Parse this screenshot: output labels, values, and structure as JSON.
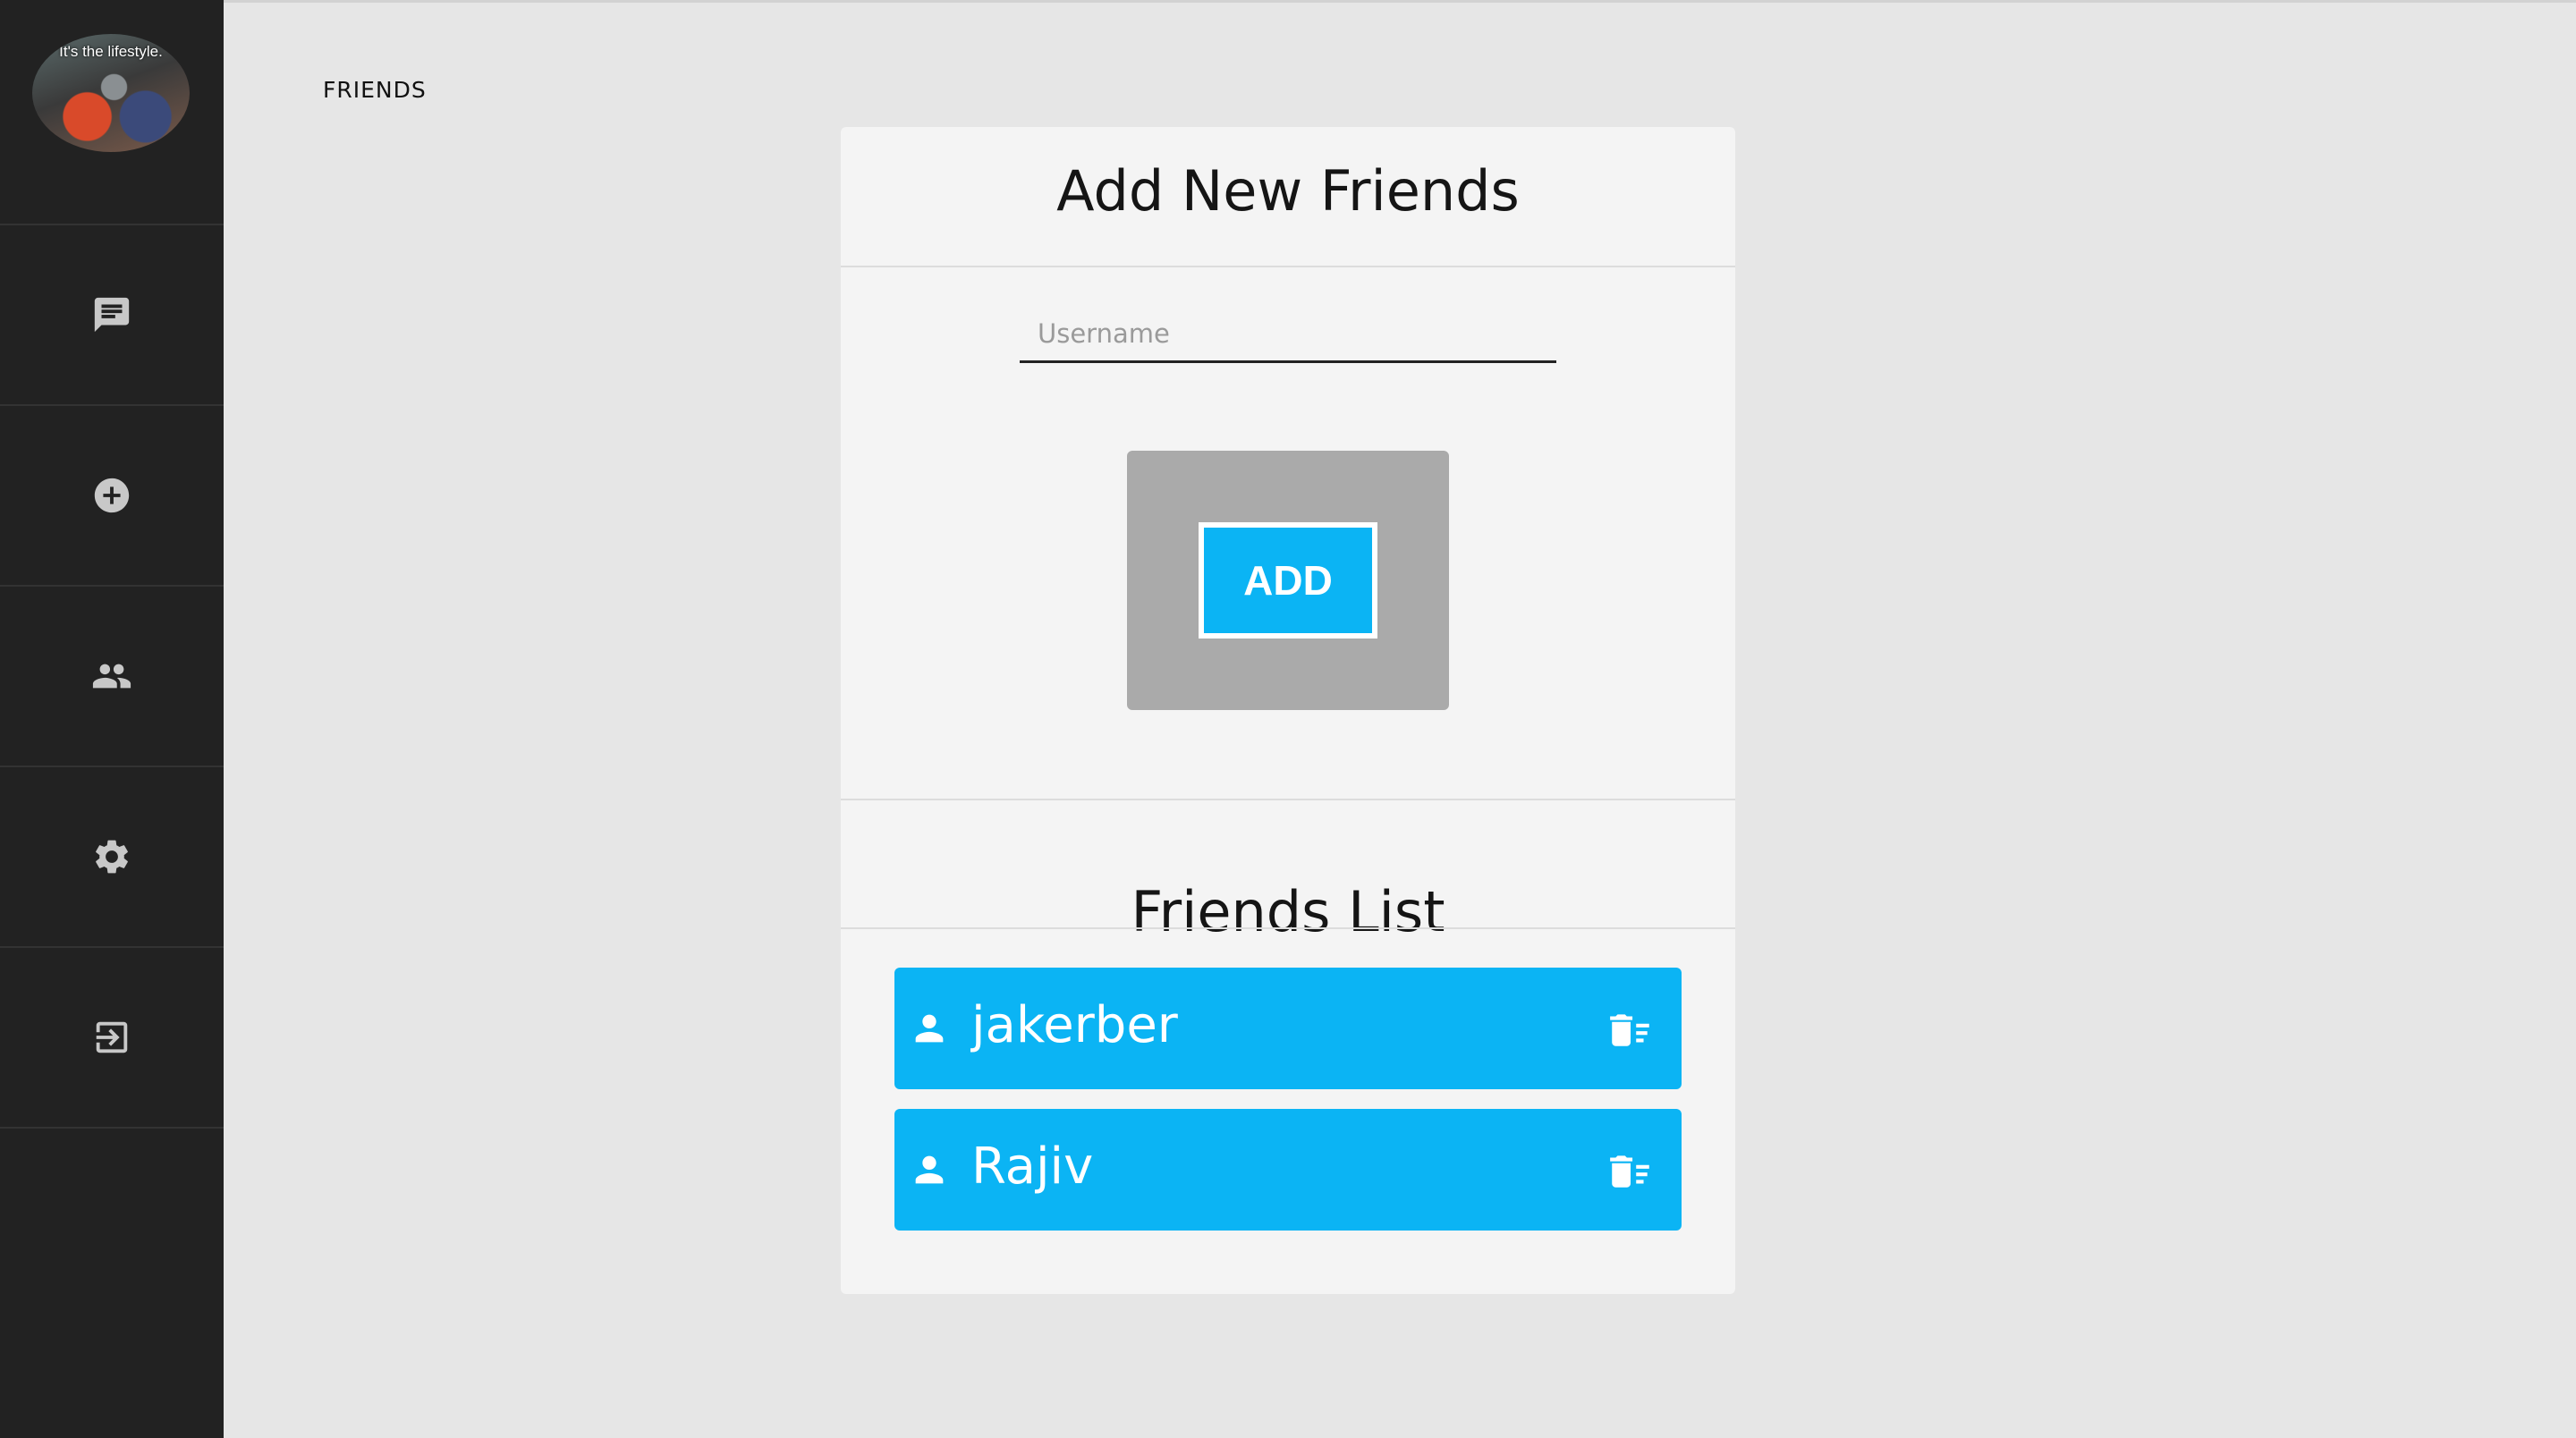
{
  "page": {
    "title": "FRIENDS"
  },
  "sidebar": {
    "avatar_caption": "It's the lifestyle.",
    "items": [
      {
        "icon": "chat-icon",
        "label": "Chats"
      },
      {
        "icon": "add-circle-icon",
        "label": "New"
      },
      {
        "icon": "people-icon",
        "label": "Friends"
      },
      {
        "icon": "gear-icon",
        "label": "Settings"
      },
      {
        "icon": "logout-icon",
        "label": "Logout"
      }
    ]
  },
  "add_section": {
    "heading": "Add New Friends",
    "username_placeholder": "Username",
    "username_value": "",
    "add_label": "ADD"
  },
  "friends_section": {
    "heading": "Friends List",
    "friends": [
      {
        "name": "jakerber"
      },
      {
        "name": "Rajiv"
      }
    ]
  },
  "colors": {
    "sidebar_bg": "#222222",
    "accent": "#0bb4f4",
    "page_bg": "#e6e6e6",
    "card_bg": "#f4f4f4",
    "add_box_bg": "#aaaaaa"
  }
}
